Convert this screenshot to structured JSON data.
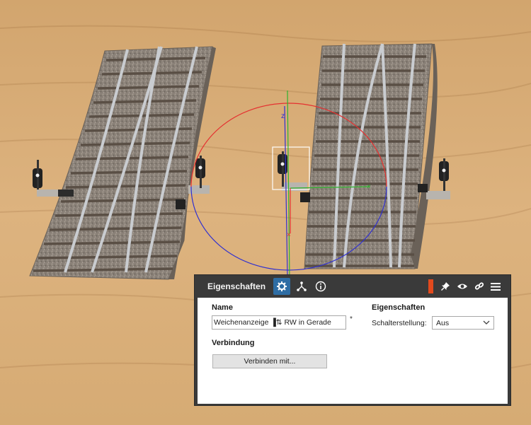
{
  "colors": {
    "ground": "#d9ae78",
    "panel_bg": "#3a3a3a",
    "panel_body": "#ffffff",
    "active_tab": "#2e6da4",
    "accent_bar": "#e2491d",
    "gizmo_red": "#e53030",
    "gizmo_green": "#2fb32f",
    "gizmo_blue": "#3030d0"
  },
  "viewport": {
    "gizmo_axis_label": "z"
  },
  "panel": {
    "title": "Eigenschaften",
    "tabs": [
      {
        "icon": "gear-icon"
      },
      {
        "icon": "hierarchy-icon"
      },
      {
        "icon": "info-icon"
      }
    ],
    "header_icons": [
      "pin-icon",
      "eye-icon",
      "link-icon",
      "menu-icon"
    ],
    "name_label": "Name",
    "name_value": "Weichenanzeige  ▐⇅ RW in Gerade",
    "required_mark": "*",
    "properties_label": "Eigenschaften",
    "switch_label": "Schalterstellung:",
    "switch_value": "Aus",
    "connection_label": "Verbindung",
    "connect_button": "Verbinden mit..."
  }
}
